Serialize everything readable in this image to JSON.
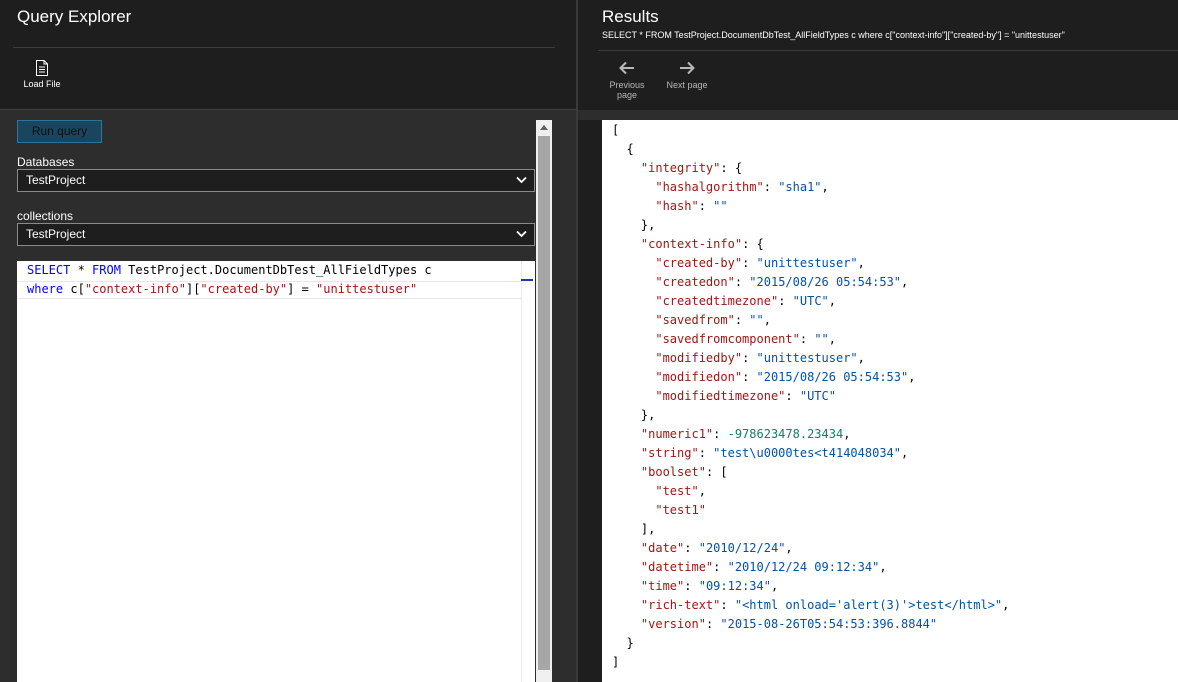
{
  "left": {
    "title": "Query Explorer",
    "load_file_label": "Load File",
    "run_query_label": "Run query",
    "databases_label": "Databases",
    "database_value": "TestProject",
    "collections_label": "collections",
    "collection_value": "TestProject",
    "query": {
      "line1": {
        "kw1": "SELECT",
        "t1": " * ",
        "kw2": "FROM",
        "t2": " TestProject.DocumentDbTest_AllFieldTypes c"
      },
      "line2": {
        "kw1": "where",
        "t1": " c[",
        "s1": "\"context-info\"",
        "t2": "][",
        "s2": "\"created-by\"",
        "t3": "] = ",
        "s3": "\"unittestuser\""
      }
    }
  },
  "right": {
    "title": "Results",
    "subtitle": "SELECT * FROM TestProject.DocumentDbTest_AllFieldTypes c where c[\"context-info\"][\"created-by\"] = \"unittestuser\"",
    "prev_label_1": "Previous",
    "prev_label_2": "page",
    "next_label": "Next page"
  },
  "results": [
    {
      "pre": "[",
      "key": "",
      "sep": "",
      "val": "",
      "vtype": "",
      "post": ""
    },
    {
      "pre": "  {",
      "key": "",
      "sep": "",
      "val": "",
      "vtype": "",
      "post": ""
    },
    {
      "pre": "    ",
      "key": "\"integrity\"",
      "sep": ": {",
      "val": "",
      "vtype": "",
      "post": ""
    },
    {
      "pre": "      ",
      "key": "\"hashalgorithm\"",
      "sep": ": ",
      "val": "\"sha1\"",
      "vtype": "s",
      "post": ","
    },
    {
      "pre": "      ",
      "key": "\"hash\"",
      "sep": ": ",
      "val": "\"\"",
      "vtype": "s",
      "post": ""
    },
    {
      "pre": "    },",
      "key": "",
      "sep": "",
      "val": "",
      "vtype": "",
      "post": ""
    },
    {
      "pre": "    ",
      "key": "\"context-info\"",
      "sep": ": {",
      "val": "",
      "vtype": "",
      "post": ""
    },
    {
      "pre": "      ",
      "key": "\"created-by\"",
      "sep": ": ",
      "val": "\"unittestuser\"",
      "vtype": "s",
      "post": ","
    },
    {
      "pre": "      ",
      "key": "\"createdon\"",
      "sep": ": ",
      "val": "\"2015/08/26 05:54:53\"",
      "vtype": "s",
      "post": ","
    },
    {
      "pre": "      ",
      "key": "\"createdtimezone\"",
      "sep": ": ",
      "val": "\"UTC\"",
      "vtype": "s",
      "post": ","
    },
    {
      "pre": "      ",
      "key": "\"savedfrom\"",
      "sep": ": ",
      "val": "\"\"",
      "vtype": "s",
      "post": ","
    },
    {
      "pre": "      ",
      "key": "\"savedfromcomponent\"",
      "sep": ": ",
      "val": "\"\"",
      "vtype": "s",
      "post": ","
    },
    {
      "pre": "      ",
      "key": "\"modifiedby\"",
      "sep": ": ",
      "val": "\"unittestuser\"",
      "vtype": "s",
      "post": ","
    },
    {
      "pre": "      ",
      "key": "\"modifiedon\"",
      "sep": ": ",
      "val": "\"2015/08/26 05:54:53\"",
      "vtype": "s",
      "post": ","
    },
    {
      "pre": "      ",
      "key": "\"modifiedtimezone\"",
      "sep": ": ",
      "val": "\"UTC\"",
      "vtype": "s",
      "post": ""
    },
    {
      "pre": "    },",
      "key": "",
      "sep": "",
      "val": "",
      "vtype": "",
      "post": ""
    },
    {
      "pre": "    ",
      "key": "\"numeric1\"",
      "sep": ": ",
      "val": "-978623478.23434",
      "vtype": "n",
      "post": ","
    },
    {
      "pre": "    ",
      "key": "\"string\"",
      "sep": ": ",
      "val": "\"test\\u0000tes<t414048034\"",
      "vtype": "s",
      "post": ","
    },
    {
      "pre": "    ",
      "key": "\"boolset\"",
      "sep": ": [",
      "val": "",
      "vtype": "",
      "post": ""
    },
    {
      "pre": "      ",
      "key": "",
      "sep": "",
      "val": "\"test\"",
      "vtype": "k",
      "post": ","
    },
    {
      "pre": "      ",
      "key": "",
      "sep": "",
      "val": "\"test1\"",
      "vtype": "k",
      "post": ""
    },
    {
      "pre": "    ],",
      "key": "",
      "sep": "",
      "val": "",
      "vtype": "",
      "post": ""
    },
    {
      "pre": "    ",
      "key": "\"date\"",
      "sep": ": ",
      "val": "\"2010/12/24\"",
      "vtype": "s",
      "post": ","
    },
    {
      "pre": "    ",
      "key": "\"datetime\"",
      "sep": ": ",
      "val": "\"2010/12/24 09:12:34\"",
      "vtype": "s",
      "post": ","
    },
    {
      "pre": "    ",
      "key": "\"time\"",
      "sep": ": ",
      "val": "\"09:12:34\"",
      "vtype": "s",
      "post": ","
    },
    {
      "pre": "    ",
      "key": "\"rich-text\"",
      "sep": ": ",
      "val": "\"<html onload='alert(3)'>test</html>\"",
      "vtype": "s",
      "post": ","
    },
    {
      "pre": "    ",
      "key": "\"version\"",
      "sep": ": ",
      "val": "\"2015-08-26T05:54:53:396.8844\"",
      "vtype": "s",
      "post": ""
    },
    {
      "pre": "  }",
      "key": "",
      "sep": "",
      "val": "",
      "vtype": "",
      "post": ""
    },
    {
      "pre": "]",
      "key": "",
      "sep": "",
      "val": "",
      "vtype": "",
      "post": ""
    }
  ]
}
